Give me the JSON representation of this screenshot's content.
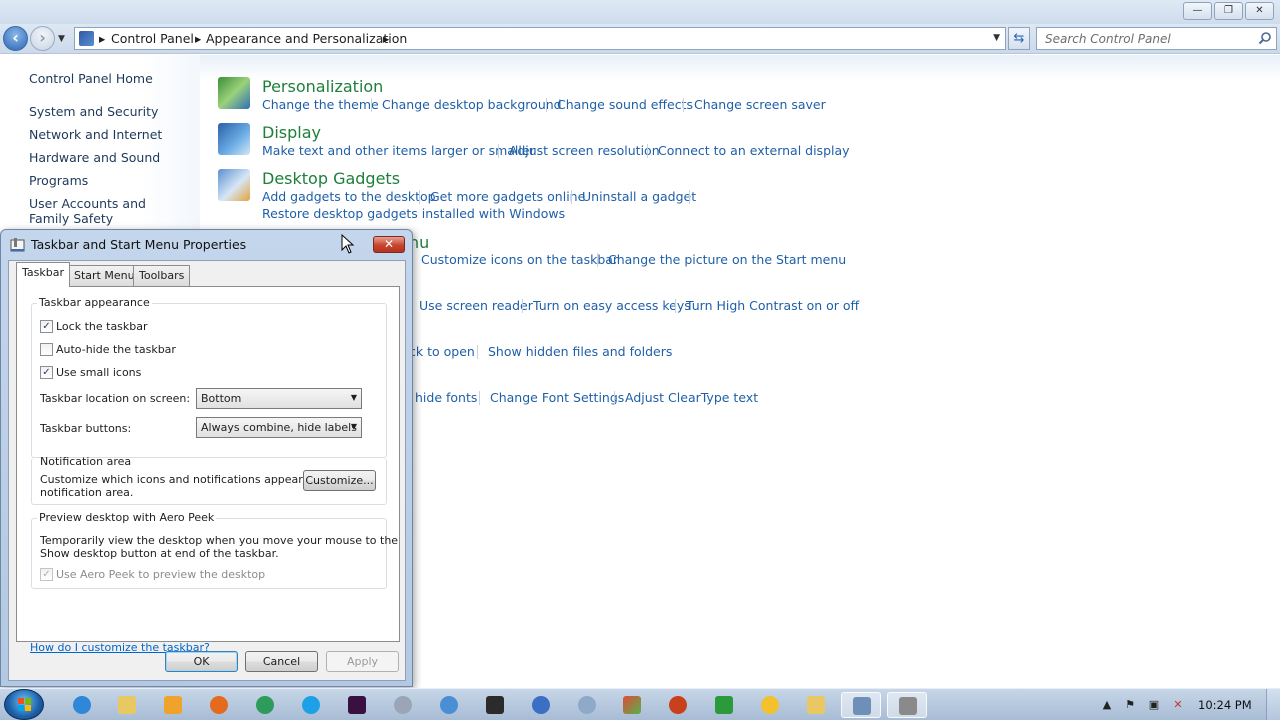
{
  "window": {
    "controls": {
      "minimize": "—",
      "maximize": "❐",
      "close": "✕"
    }
  },
  "navigation": {
    "breadcrumbs": [
      "Control Panel",
      "Appearance and Personalization"
    ],
    "search_placeholder": "Search Control Panel"
  },
  "left_pane": {
    "home": "Control Panel Home",
    "items": [
      "System and Security",
      "Network and Internet",
      "Hardware and Sound",
      "Programs",
      "User Accounts and Family Safety"
    ]
  },
  "categories": [
    {
      "title": "Personalization",
      "links": [
        "Change the theme",
        "Change desktop background",
        "Change sound effects",
        "Change screen saver"
      ]
    },
    {
      "title": "Display",
      "links": [
        "Make text and other items larger or smaller",
        "Adjust screen resolution",
        "Connect to an external display"
      ]
    },
    {
      "title": "Desktop Gadgets",
      "links": [
        "Add gadgets to the desktop",
        "Get more gadgets online",
        "Uninstall a gadget",
        "Restore desktop gadgets installed with Windows"
      ]
    },
    {
      "title_partial": "nu",
      "links": [
        "Customize icons on the taskbar",
        "Change the picture on the Start menu"
      ]
    },
    {
      "links": [
        "Use screen reader",
        "Turn on easy access keys",
        "Turn High Contrast on or off"
      ]
    },
    {
      "links": [
        "ck to open",
        "Show hidden files and folders"
      ]
    },
    {
      "links": [
        "hide fonts",
        "Change Font Settings",
        "Adjust ClearType text"
      ]
    }
  ],
  "dialog": {
    "title": "Taskbar and Start Menu Properties",
    "close": "✕",
    "tabs": [
      "Taskbar",
      "Start Menu",
      "Toolbars"
    ],
    "active_tab": "Taskbar",
    "appearance": {
      "group_title": "Taskbar appearance",
      "lock": {
        "label": "Lock the taskbar",
        "checked": true
      },
      "autohide": {
        "label": "Auto-hide the taskbar",
        "checked": false
      },
      "small_icons": {
        "label": "Use small icons",
        "checked": true
      },
      "location_label": "Taskbar location on screen:",
      "location_value": "Bottom",
      "buttons_label": "Taskbar buttons:",
      "buttons_value": "Always combine, hide labels"
    },
    "notification": {
      "group_title": "Notification area",
      "line1": "Customize which icons and notifications appear in the",
      "line2": "notification area.",
      "customize_button": "Customize..."
    },
    "aero_peek": {
      "group_title": "Preview desktop with Aero Peek",
      "line1": "Temporarily view the desktop when you move your mouse to the",
      "line2": "Show desktop button at end of the taskbar.",
      "checkbox": {
        "label": "Use Aero Peek to preview the desktop",
        "checked": true,
        "disabled": true
      }
    },
    "help_link": "How do I customize the taskbar?",
    "buttons": {
      "ok": "OK",
      "cancel": "Cancel",
      "apply": "Apply"
    },
    "check_glyph": "✓"
  },
  "taskbar": {
    "items": [
      "internet-explorer",
      "windows-explorer",
      "media-player",
      "firefox",
      "chrome",
      "skype",
      "app-purple",
      "app-settings",
      "itunes",
      "media-center",
      "safari",
      "app-globe",
      "control-panel",
      "app-red",
      "app-green",
      "app-smiley",
      "app-folder",
      "app-active",
      "app-active-current"
    ],
    "tray_arrow": "▲",
    "time": "10:24 PM"
  }
}
